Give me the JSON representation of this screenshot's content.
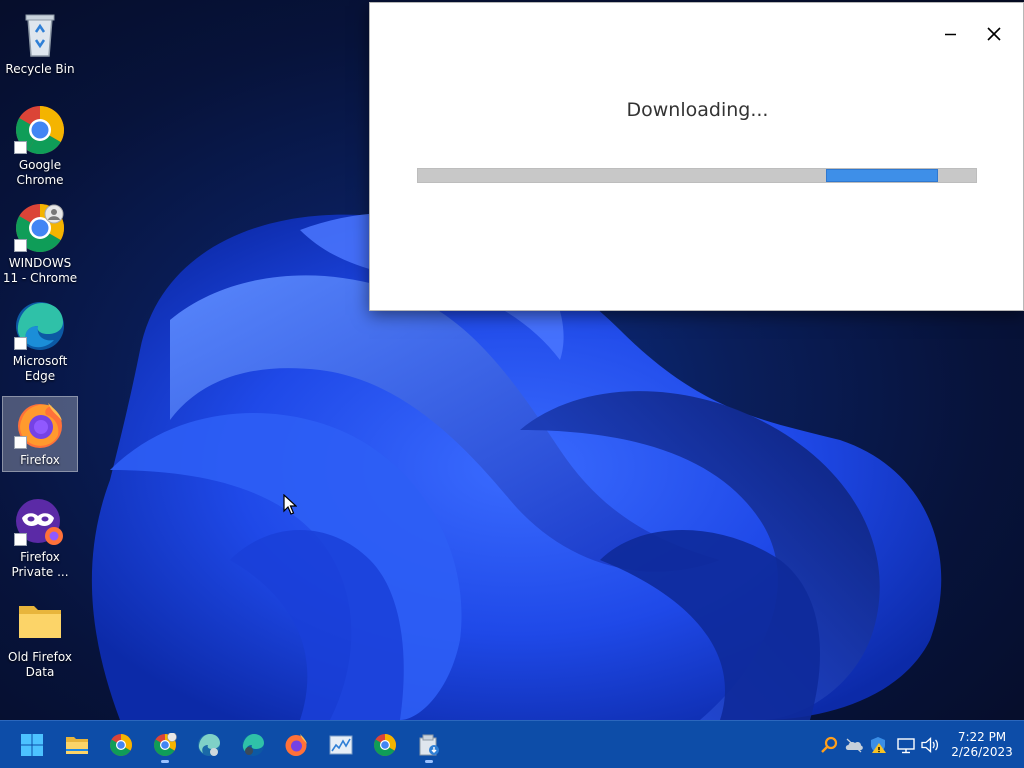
{
  "desktop": {
    "icons": [
      {
        "label": "Recycle Bin",
        "icon": "recycle-bin-icon"
      },
      {
        "label": "Google Chrome",
        "icon": "chrome-icon"
      },
      {
        "label": "WINDOWS 11 - Chrome",
        "icon": "chrome-profile-icon"
      },
      {
        "label": "Microsoft Edge",
        "icon": "edge-icon"
      },
      {
        "label": "Firefox",
        "icon": "firefox-icon",
        "selected": true
      },
      {
        "label": "Firefox Private ...",
        "icon": "firefox-private-icon"
      },
      {
        "label": "Old Firefox Data",
        "icon": "folder-icon"
      }
    ]
  },
  "download_window": {
    "title": "Downloading...",
    "progress_state": "indeterminate",
    "buttons": {
      "minimize": "minimize-icon",
      "close": "close-icon"
    },
    "colors": {
      "progress_fill": "#3e8fe8",
      "progress_track": "#c8c8c8"
    }
  },
  "taskbar": {
    "pinned": [
      {
        "icon": "start-icon"
      },
      {
        "icon": "file-explorer-icon"
      },
      {
        "icon": "chrome-icon"
      },
      {
        "icon": "chrome-profile-icon"
      },
      {
        "icon": "edge-beta-icon"
      },
      {
        "icon": "edge-dev-icon"
      },
      {
        "icon": "firefox-icon"
      },
      {
        "icon": "task-manager-icon"
      },
      {
        "icon": "chrome-icon"
      },
      {
        "icon": "installer-icon",
        "active": true
      }
    ],
    "tray": [
      {
        "icon": "search-key-icon"
      },
      {
        "icon": "onedrive-icon"
      },
      {
        "icon": "security-warning-icon"
      },
      {
        "icon": "network-icon"
      },
      {
        "icon": "volume-icon"
      }
    ],
    "clock": {
      "time": "7:22 PM",
      "date": "2/26/2023"
    },
    "colors": {
      "taskbar": "#0d4da8"
    }
  }
}
